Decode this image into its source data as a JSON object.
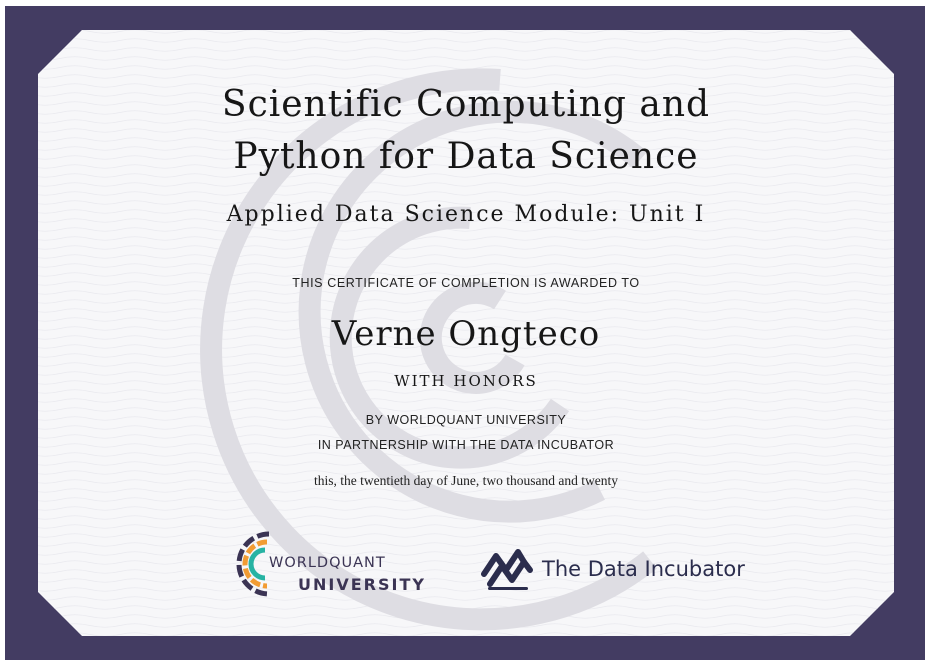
{
  "certificate": {
    "title_line1": "Scientific Computing and",
    "title_line2": "Python for Data Science",
    "subtitle": "Applied Data Science Module: Unit I",
    "awarded_text": "THIS CERTIFICATE OF COMPLETION IS AWARDED TO",
    "recipient": "Verne Ongteco",
    "distinction": "WITH HONORS",
    "issuer_line": "BY WORLDQUANT UNIVERSITY",
    "partner_line": "IN PARTNERSHIP WITH THE DATA INCUBATOR",
    "date_line": "this, the twentieth day of June, two thousand and twenty"
  },
  "logos": {
    "worldquant": {
      "line1": "WORLDQUANT",
      "line2": "UNIVERSITY",
      "icon": "worldquant-logo-icon"
    },
    "data_incubator": {
      "name": "The Data Incubator",
      "icon": "data-incubator-logo-icon"
    }
  },
  "colors": {
    "frame": "#433c62",
    "paper": "#f7f7f9",
    "text": "#161616",
    "watermark": "#dedde3",
    "wq_orange": "#f29c33",
    "wq_teal": "#27b3a3",
    "wq_navy": "#3b3454",
    "tdi_navy": "#2b2d4d"
  }
}
